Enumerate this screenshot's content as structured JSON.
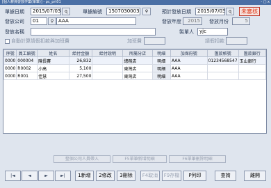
{
  "window": {
    "title": "[個人薪資發放作業(單筆)] - pc_prt01",
    "controls": "- □ x"
  },
  "form": {
    "doc_date_label": "單據日期",
    "doc_date": "2015/07/03",
    "doc_no_label": "單據編號",
    "doc_no": "1507030003",
    "plan_date_label": "預計發放日期",
    "plan_date": "2015/07/03",
    "status_badge": "未審核",
    "company_label": "發放公司",
    "company_code": "01",
    "company_name": "AAA",
    "year_label": "發放年度",
    "year": "2015",
    "month_label": "發放月份",
    "month": "5",
    "name_label": "發放名稱",
    "name": "",
    "creator_label": "製單人",
    "creator": "yjc",
    "auto_calc_label": "自動計算請假扣款與加班費",
    "overtime_label": "加班費",
    "overtime": "",
    "leave_deduct_label": "請假扣款",
    "leave_deduct": ""
  },
  "icons": {
    "lookup": "magnifier-icon",
    "calendar": "calendar-icon"
  },
  "grid": {
    "headers": [
      "序號",
      "員工編號",
      "姓名",
      "給付金額",
      "給付說明",
      "所屬分店",
      "明細",
      "加保府號",
      "匯款帳號",
      "匯款銀行"
    ],
    "rows": [
      {
        "seq": "0000",
        "emp_id": "000004",
        "name": "陳長賽",
        "amount": "26,832",
        "desc": "",
        "branch": "總務店",
        "detail": "明細",
        "insure": "AAA",
        "account": "01234568547",
        "bank": "玉山銀行"
      },
      {
        "seq": "0000",
        "emp_id": "R0002",
        "name": "小高",
        "amount": "5,100",
        "desc": "",
        "branch": "東灣店",
        "detail": "明細",
        "insure": "AAA",
        "account": "",
        "bank": ""
      },
      {
        "seq": "0000",
        "emp_id": "R001",
        "name": "佳慧",
        "amount": "27,500",
        "desc": "",
        "branch": "東灣店",
        "detail": "明細",
        "insure": "AAA",
        "account": "",
        "bank": ""
      }
    ]
  },
  "mid_buttons": {
    "import_company": "整個公司人員帶入",
    "add_detail": "F5單筆新增明細",
    "delete_detail": "F6單筆刪除明細"
  },
  "bottom": {
    "nav_first": "|◄",
    "nav_prev": "◄",
    "nav_next": "►",
    "nav_last": "►|",
    "add": "1新增",
    "edit": "2修改",
    "delete": "3刪除",
    "cancel": "F4取消",
    "save": "F9存檔",
    "print": "P列印",
    "query": "查詢",
    "close": "離開"
  }
}
